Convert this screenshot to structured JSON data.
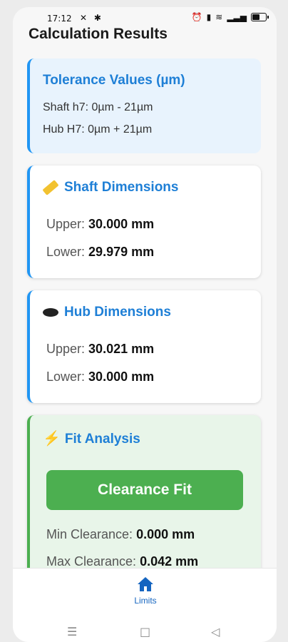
{
  "status_bar": {
    "time": "17:12",
    "left_icons": "✕ ✱",
    "right_icons": "⏰ 📳 📶 ▮▮▮"
  },
  "page": {
    "title": "Calculation Results"
  },
  "tolerance_card": {
    "title": "Tolerance Values (µm)",
    "shaft_line": "Shaft h7: 0µm - 21µm",
    "hub_line": "Hub H7: 0µm + 21µm"
  },
  "shaft_card": {
    "title": "Shaft Dimensions",
    "upper_label": "Upper:",
    "upper_value": "30.000 mm",
    "lower_label": "Lower:",
    "lower_value": "29.979 mm"
  },
  "hub_card": {
    "title": "Hub Dimensions",
    "upper_label": "Upper:",
    "upper_value": "30.021 mm",
    "lower_label": "Lower:",
    "lower_value": "30.000 mm"
  },
  "fit_card": {
    "title": "Fit Analysis",
    "fit_type": "Clearance Fit",
    "min_label": "Min Clearance:",
    "min_value": "0.000 mm",
    "max_label": "Max Clearance:",
    "max_value": "0.042 mm"
  },
  "bottom_nav": {
    "home_label": "Limits"
  },
  "colors": {
    "accent_blue": "#2196f3",
    "title_blue": "#1e7fd6",
    "fit_green": "#4caf50"
  }
}
